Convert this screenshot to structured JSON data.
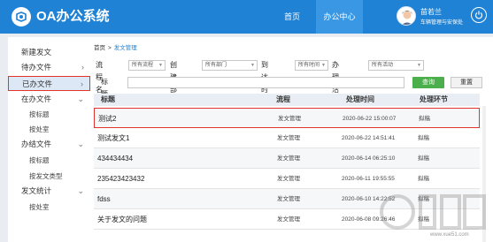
{
  "header": {
    "app_title": "OA办公系统",
    "nav": [
      {
        "label": "首页"
      },
      {
        "label": "办公中心"
      }
    ],
    "user": {
      "name": "苗若兰",
      "role": "车辆管理与安保处"
    }
  },
  "sidebar": {
    "items": [
      {
        "label": "新建发文"
      },
      {
        "label": "待办文件"
      },
      {
        "label": "已办文件"
      },
      {
        "label": "在办文件"
      },
      {
        "label": "按标题"
      },
      {
        "label": "按处室"
      },
      {
        "label": "办结文件"
      },
      {
        "label": "按标题"
      },
      {
        "label": "按发文类型"
      },
      {
        "label": "发文统计"
      },
      {
        "label": "按处室"
      }
    ]
  },
  "breadcrumb": {
    "home": "首页",
    "sep": ">",
    "current": "发文管理"
  },
  "filters": {
    "flow_label": "流程名称",
    "flow_value": "所有流程",
    "dept_label": "创建部门",
    "dept_value": "所有部门",
    "arrive_label": "到达时间",
    "arrive_value": "所有时间",
    "activity_label": "办理活动",
    "activity_value": "所有活动",
    "title_label": "标  题",
    "search_btn": "查询",
    "reset_btn": "重置"
  },
  "table": {
    "headers": {
      "title": "标题",
      "flow": "流程",
      "time": "处理时间",
      "step": "处理环节"
    },
    "rows": [
      {
        "title": "测试2",
        "flow": "发文管理",
        "time": "2020-06-22 15:00:07",
        "step": "拟稿"
      },
      {
        "title": "测试发文1",
        "flow": "发文管理",
        "time": "2020-06-22 14:51:41",
        "step": "拟稿"
      },
      {
        "title": "434434434",
        "flow": "发文管理",
        "time": "2020-06-14 06:25:10",
        "step": "拟稿"
      },
      {
        "title": "235423423432",
        "flow": "发文管理",
        "time": "2020-06-11 19:55:55",
        "step": "拟稿"
      },
      {
        "title": "fdss",
        "flow": "发文管理",
        "time": "2020-06-10 14:22:52",
        "step": "拟稿"
      },
      {
        "title": "关于发文的问题",
        "flow": "发文管理",
        "time": "2020-06-08 09:26:46",
        "step": "拟稿"
      }
    ]
  },
  "watermark": {
    "url": "www.xue51.com"
  },
  "colors": {
    "header": "#1f82d4",
    "active_nav": "#3a97e3",
    "highlight_border": "#e2332d",
    "search_button": "#4bb04b"
  }
}
